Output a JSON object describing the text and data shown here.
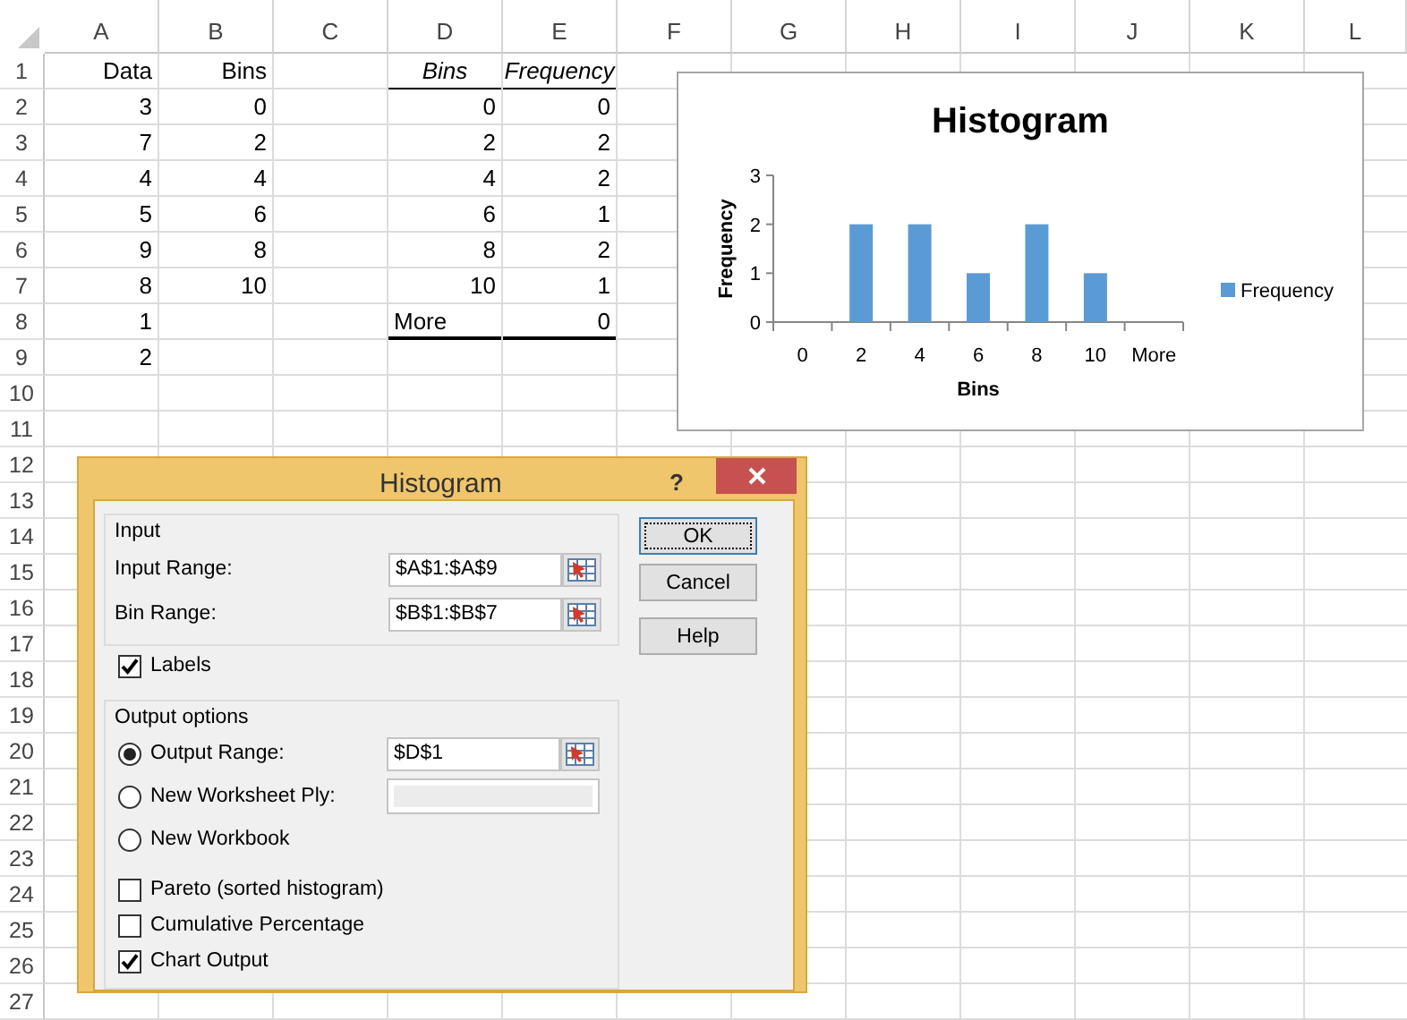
{
  "sheet": {
    "columns": [
      "A",
      "B",
      "C",
      "D",
      "E",
      "F",
      "G",
      "H",
      "I",
      "J",
      "K",
      "L"
    ],
    "rows": [
      {
        "number": "1",
        "cells": [
          {
            "text": "Data",
            "kind": "label"
          },
          {
            "text": "Bins",
            "kind": "label"
          },
          null,
          {
            "text": "Bins",
            "kind": "header"
          },
          {
            "text": "Frequency",
            "kind": "header"
          }
        ]
      },
      {
        "number": "2",
        "cells": [
          {
            "text": "3",
            "kind": "number"
          },
          {
            "text": "0",
            "kind": "number"
          },
          null,
          {
            "text": "0",
            "kind": "number"
          },
          {
            "text": "0",
            "kind": "number"
          }
        ]
      },
      {
        "number": "3",
        "cells": [
          {
            "text": "7",
            "kind": "number"
          },
          {
            "text": "2",
            "kind": "number"
          },
          null,
          {
            "text": "2",
            "kind": "number"
          },
          {
            "text": "2",
            "kind": "number"
          }
        ]
      },
      {
        "number": "4",
        "cells": [
          {
            "text": "4",
            "kind": "number"
          },
          {
            "text": "4",
            "kind": "number"
          },
          null,
          {
            "text": "4",
            "kind": "number"
          },
          {
            "text": "2",
            "kind": "number"
          }
        ]
      },
      {
        "number": "5",
        "cells": [
          {
            "text": "5",
            "kind": "number"
          },
          {
            "text": "6",
            "kind": "number"
          },
          null,
          {
            "text": "6",
            "kind": "number"
          },
          {
            "text": "1",
            "kind": "number"
          }
        ]
      },
      {
        "number": "6",
        "cells": [
          {
            "text": "9",
            "kind": "number"
          },
          {
            "text": "8",
            "kind": "number"
          },
          null,
          {
            "text": "8",
            "kind": "number"
          },
          {
            "text": "2",
            "kind": "number"
          }
        ]
      },
      {
        "number": "7",
        "cells": [
          {
            "text": "8",
            "kind": "number"
          },
          {
            "text": "10",
            "kind": "number"
          },
          null,
          {
            "text": "10",
            "kind": "number"
          },
          {
            "text": "1",
            "kind": "number"
          }
        ]
      },
      {
        "number": "8",
        "cells": [
          {
            "text": "1",
            "kind": "number"
          },
          null,
          null,
          {
            "text": "More",
            "kind": "text",
            "rule_below": true
          },
          {
            "text": "0",
            "kind": "number",
            "rule_below": true
          }
        ]
      },
      {
        "number": "9",
        "cells": [
          {
            "text": "2",
            "kind": "number"
          }
        ]
      },
      {
        "number": "10"
      },
      {
        "number": "11"
      },
      {
        "number": "12"
      },
      {
        "number": "13"
      },
      {
        "number": "14"
      },
      {
        "number": "15"
      },
      {
        "number": "16"
      },
      {
        "number": "17"
      },
      {
        "number": "18"
      },
      {
        "number": "19"
      },
      {
        "number": "20"
      },
      {
        "number": "21"
      },
      {
        "number": "22"
      },
      {
        "number": "23"
      },
      {
        "number": "24"
      },
      {
        "number": "25"
      },
      {
        "number": "26"
      },
      {
        "number": "27"
      }
    ]
  },
  "chart": {
    "chart_data": {
      "type": "bar",
      "title": "Histogram",
      "xlabel": "Bins",
      "ylabel": "Frequency",
      "categories": [
        "0",
        "2",
        "4",
        "6",
        "8",
        "10",
        "More"
      ],
      "series": [
        {
          "name": "Frequency",
          "color": "#5b9bd5",
          "values": [
            0,
            2,
            2,
            1,
            2,
            1,
            0
          ]
        }
      ],
      "ylim": [
        0,
        3
      ],
      "yticks": [
        0,
        1,
        2,
        3
      ]
    }
  },
  "dialog": {
    "title": "Histogram",
    "help": "?",
    "input": {
      "legend": "Input",
      "fields": [
        {
          "label": "Input Range:",
          "value": "$A$1:$A$9"
        },
        {
          "label": "Bin Range:",
          "value": "$B$1:$B$7"
        }
      ]
    },
    "labels_option": {
      "label": "Labels",
      "checked": true
    },
    "output": {
      "legend": "Output options",
      "destinations": [
        {
          "label": "Output Range:",
          "selected": true,
          "field": {
            "value": "$D$1",
            "disabled": false
          }
        },
        {
          "label": "New Worksheet Ply:",
          "selected": false,
          "field": {
            "disabled": true
          }
        },
        {
          "label": "New Workbook",
          "selected": false
        }
      ],
      "options": [
        {
          "label": "Pareto (sorted histogram)",
          "checked": false
        },
        {
          "label": "Cumulative Percentage",
          "checked": false
        },
        {
          "label": "Chart Output",
          "checked": true
        }
      ]
    },
    "buttons": [
      {
        "label": "OK",
        "focused": true
      },
      {
        "label": "Cancel",
        "focused": false
      },
      {
        "label": "Help",
        "focused": false
      }
    ]
  }
}
